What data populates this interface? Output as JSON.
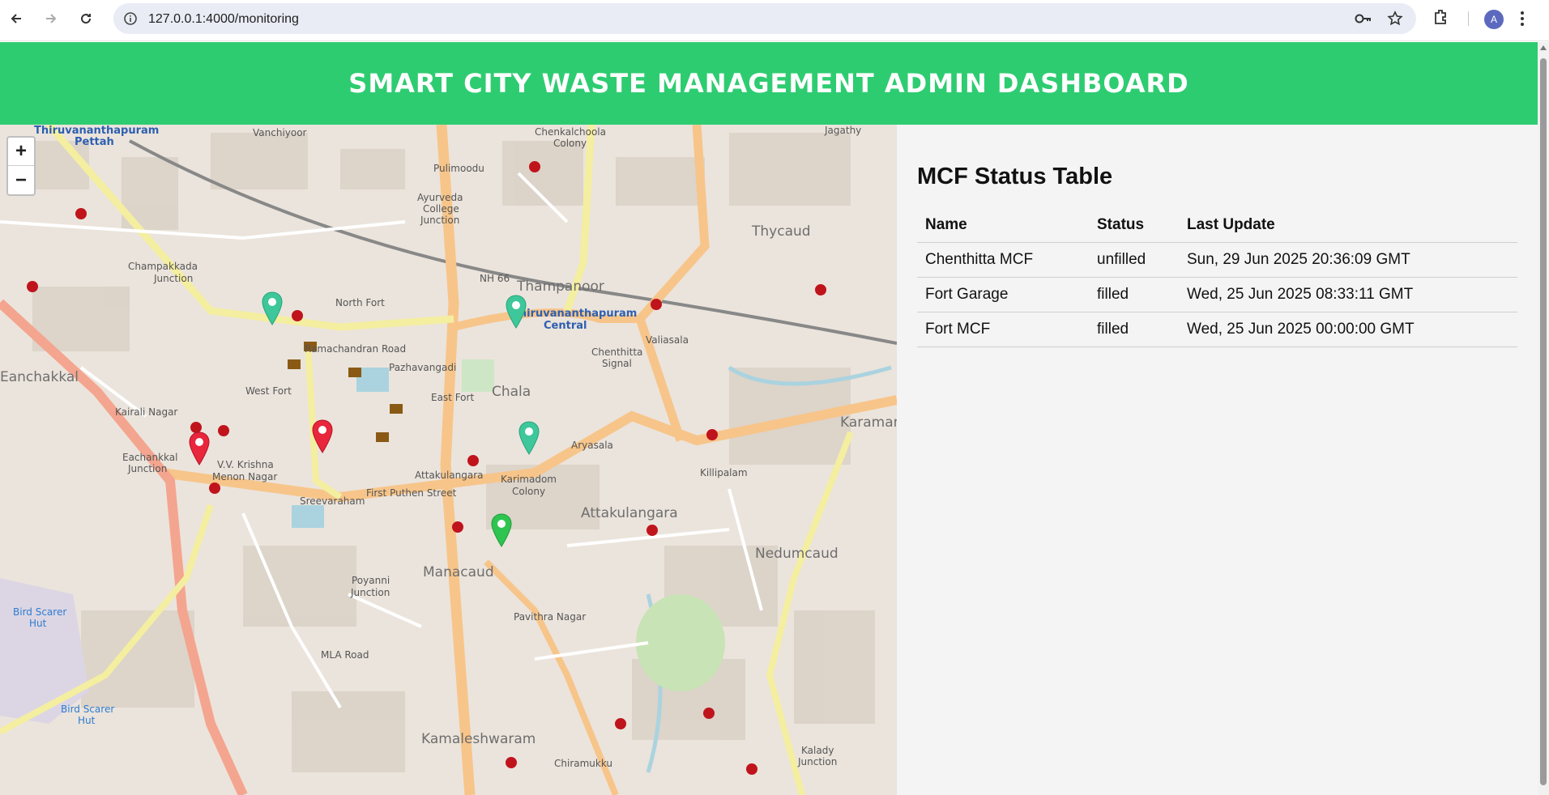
{
  "browser": {
    "url": "127.0.0.1:4000/monitoring",
    "avatar_letter": "A"
  },
  "header": {
    "title": "SMART CITY WASTE MANAGEMENT ADMIN DASHBOARD",
    "color": "#2ecc71"
  },
  "map": {
    "zoom_in": "+",
    "zoom_out": "−",
    "labels": [
      "Thiruvananthapuram",
      "Pettah",
      "Vanchiyoor",
      "Chenkalchoola",
      "Colony",
      "Jagathy",
      "Pulimoodu",
      "Ayurveda",
      "College",
      "Junction",
      "Thycaud",
      "Champakkada",
      "Junction",
      "North Fort",
      "NH 66",
      "Thampanoor",
      "Thiruvananthapuram",
      "Central",
      "Chenthitta",
      "Signal",
      "Valiasala",
      "Eanchakkal",
      "Ramachandran Road",
      "Pazhavangadi",
      "West Fort",
      "East Fort",
      "Chala",
      "Kairali Nagar",
      "Eachankkal",
      "Junction",
      "V.V. Krishna",
      "Menon Nagar",
      "Attakulangara",
      "Karimadom",
      "Colony",
      "Aryasala",
      "Killipalam",
      "Karaman",
      "Sreevaraham",
      "First Puthen Street",
      "Attakulangara",
      "Nedumcaud",
      "Poyanni",
      "Junction",
      "Manacaud",
      "Bird Scarer",
      "Hut",
      "Pavithra Nagar",
      "MLA Road",
      "Bird Scarer",
      "Hut",
      "Kamaleshwaram",
      "Chiramukku",
      "Kalady",
      "Junction"
    ],
    "markers": [
      {
        "name": "Chenthitta MCF",
        "color": "green"
      },
      {
        "name": "Fort Garage",
        "color": "red"
      },
      {
        "name": "Fort MCF",
        "color": "red"
      }
    ]
  },
  "panel": {
    "title": "MCF Status Table",
    "headers": [
      "Name",
      "Status",
      "Last Update"
    ],
    "rows": [
      {
        "name": "Chenthitta MCF",
        "status": "unfilled",
        "last_update": "Sun, 29 Jun 2025 20:36:09 GMT"
      },
      {
        "name": "Fort Garage",
        "status": "filled",
        "last_update": "Wed, 25 Jun 2025 08:33:11 GMT"
      },
      {
        "name": "Fort MCF",
        "status": "filled",
        "last_update": "Wed, 25 Jun 2025 00:00:00 GMT"
      }
    ]
  }
}
